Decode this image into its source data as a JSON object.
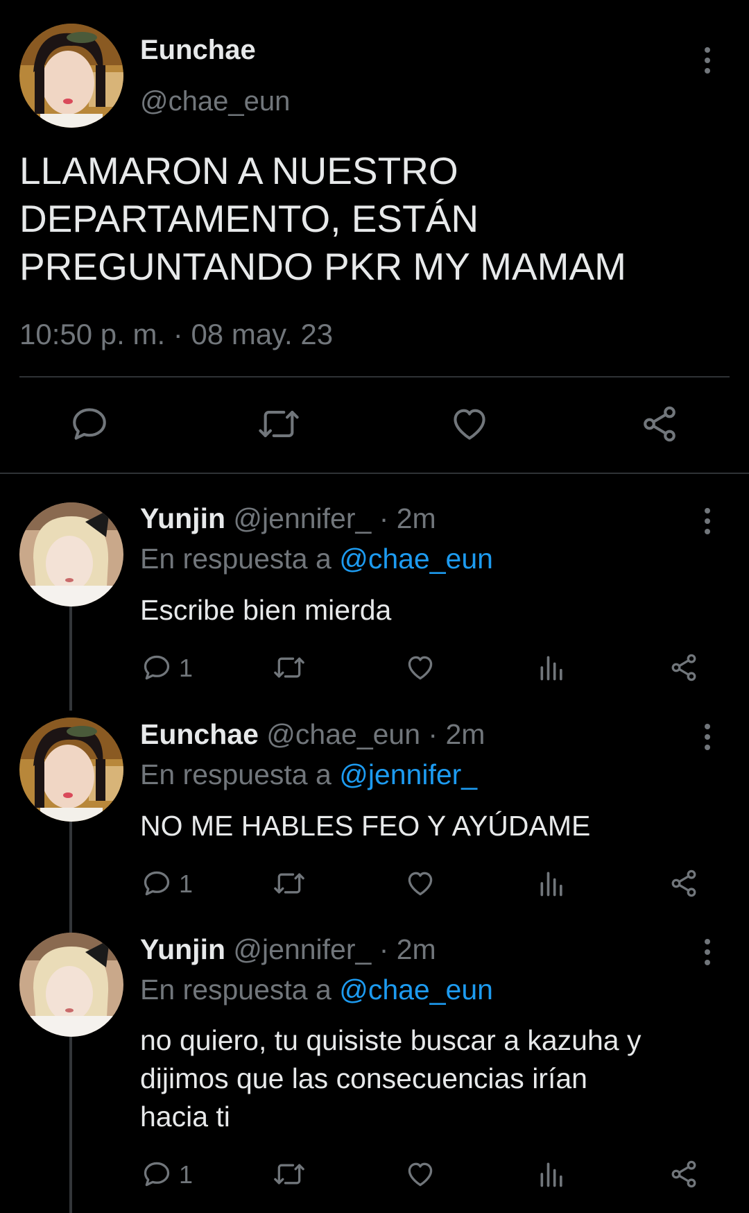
{
  "main_tweet": {
    "name": "Eunchae",
    "handle": "@chae_eun",
    "text_lines": [
      "LLAMARON A NUESTRO",
      "DEPARTAMENTO, ESTÁN",
      "PREGUNTANDO PKR MY MAMAM"
    ],
    "timestamp": "10:50 p. m. · 08 may. 23"
  },
  "icons": {
    "reply": "reply-icon",
    "retweet": "retweet-icon",
    "like": "heart-icon",
    "views": "views-icon",
    "share": "share-icon",
    "more": "more-options-icon"
  },
  "replies": [
    {
      "name": "Yunjin",
      "meta": "@jennifer_ · 2m",
      "reply_prefix": "En respuesta a",
      "reply_to": "@chae_eun",
      "text_lines": [
        "Escribe bien mierda"
      ],
      "reply_count": "1"
    },
    {
      "name": "Eunchae",
      "meta": "@chae_eun · 2m",
      "reply_prefix": "En respuesta a",
      "reply_to": "@jennifer_",
      "text_lines": [
        "NO ME HABLES FEO Y AYÚDAME"
      ],
      "reply_count": "1"
    },
    {
      "name": "Yunjin",
      "meta": "@jennifer_ · 2m",
      "reply_prefix": "En respuesta a",
      "reply_to": "@chae_eun",
      "text_lines": [
        "no quiero, tu quisiste buscar a kazuha y",
        "dijimos que las consecuencias irían",
        "hacia ti"
      ],
      "reply_count": "1"
    }
  ],
  "colors": {
    "background": "#000000",
    "text": "#e7e9ea",
    "muted": "#71767b",
    "link": "#1d9bf0",
    "divider": "#2f3336"
  }
}
